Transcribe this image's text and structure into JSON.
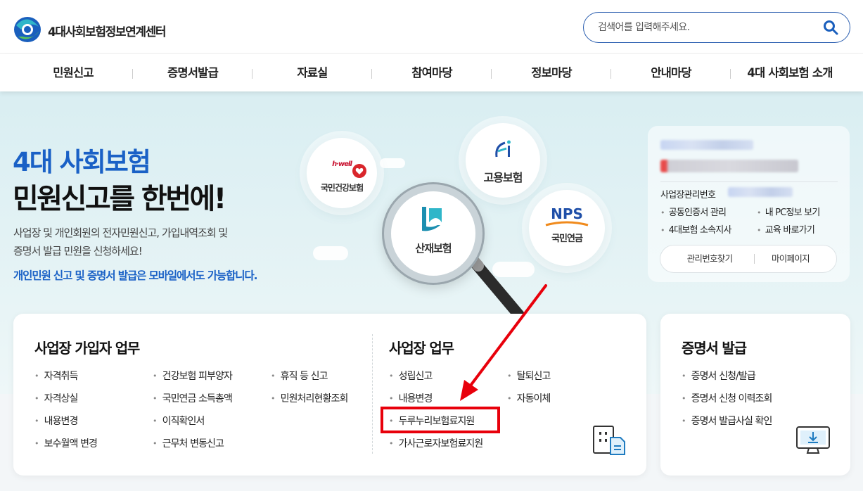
{
  "brand": {
    "name": "4대사회보험정보연계센터"
  },
  "search": {
    "placeholder": "검색어를 입력해주세요."
  },
  "nav": {
    "items": [
      "민원신고",
      "증명서발급",
      "자료실",
      "참여마당",
      "정보마당",
      "안내마당",
      "4대 사회보험 소개"
    ]
  },
  "hero": {
    "title_line1": "4대 사회보험",
    "title_line2": "민원신고를 한번에!",
    "desc_line1": "사업장 및 개인회원의 전자민원신고, 가입내역조회 및",
    "desc_line2": "증명서 발급 민원을 신청하세요!",
    "note": "개인민원 신고 및 증명서 발급은 모바일에서도 가능합니다."
  },
  "agencies": {
    "nhis": {
      "tag": "h·well",
      "name": "국민건강보험"
    },
    "employment": {
      "name": "고용보험"
    },
    "workers_comp": {
      "name": "산재보험"
    },
    "pension": {
      "logo": "NPS",
      "name": "국민연금"
    }
  },
  "login_panel": {
    "biz_mgmt_label": "사업장관리번호",
    "links": [
      "공동인증서 관리",
      "내 PC정보 보기",
      "4대보험 소속지사",
      "교육 바로가기"
    ],
    "buttons": [
      "관리번호찾기",
      "마이페이지"
    ]
  },
  "card_subscriber": {
    "title": "사업장 가입자 업무",
    "col1": [
      "자격취득",
      "자격상실",
      "내용변경",
      "보수월액 변경"
    ],
    "col2": [
      "건강보험 피부양자",
      "국민연금 소득총액",
      "이직확인서",
      "근무처 변동신고"
    ],
    "col3": [
      "휴직 등 신고",
      "민원처리현황조회"
    ]
  },
  "card_business": {
    "title": "사업장 업무",
    "col1": [
      "성립신고",
      "내용변경",
      "두루누리보험료지원",
      "가사근로자보험료지원"
    ],
    "col2": [
      "탈퇴신고",
      "자동이체"
    ]
  },
  "card_cert": {
    "title": "증명서 발급",
    "links": [
      "증명서 신청/발급",
      "증명서 신청 이력조회",
      "증명서 발급사실 확인"
    ]
  },
  "colors": {
    "primary_blue": "#1a61c6",
    "highlight_red": "#e8000b",
    "hero_bg": "#d9eef2"
  },
  "icons": [
    "logo-icon",
    "search-icon",
    "building-document-icon",
    "monitor-download-icon",
    "magnifier-icon",
    "heart-icon"
  ]
}
